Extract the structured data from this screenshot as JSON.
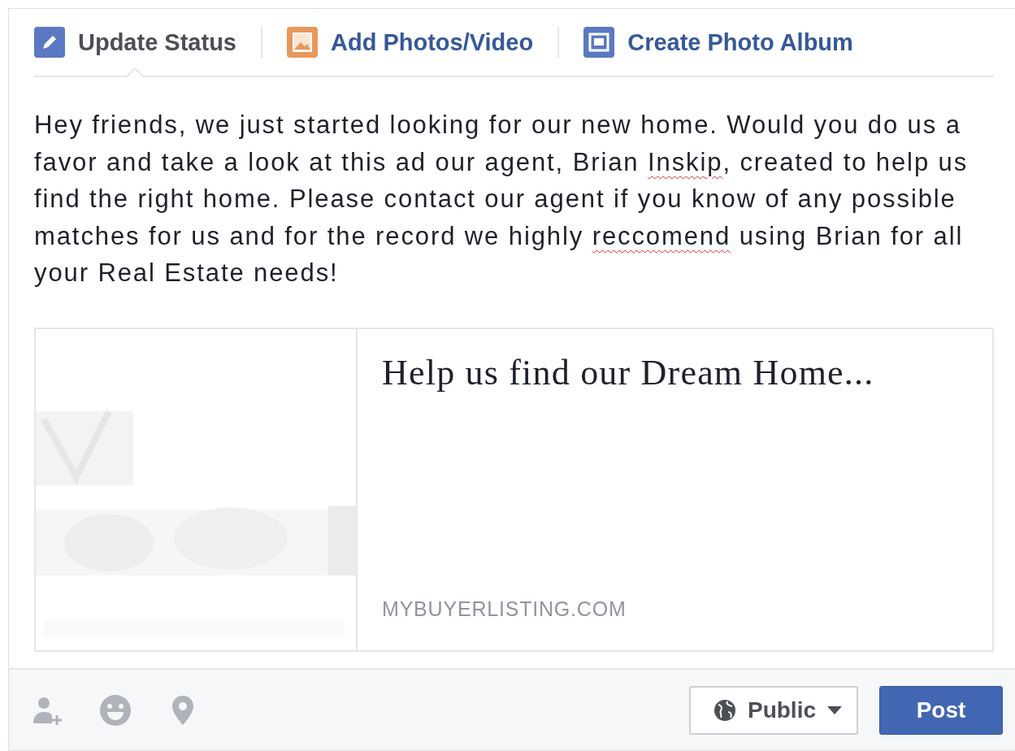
{
  "tabs": [
    {
      "label": "Update Status",
      "kind": "status",
      "selected": true
    },
    {
      "label": "Add Photos/Video",
      "selected": false
    },
    {
      "label": "Create Photo Album",
      "kind": "album",
      "selected": false
    }
  ],
  "status_text": {
    "segments": [
      {
        "text": "Hey friends, we just started looking for our new home. Would you do us a favor and take a look at this ad our agent, Brian ",
        "misspelled": false
      },
      {
        "text": "Inskip",
        "misspelled": true
      },
      {
        "text": ", created to help us find the right home. Please contact our agent if you know of any possible matches for us and for the record we highly ",
        "misspelled": false
      },
      {
        "text": "reccomend",
        "misspelled": true
      },
      {
        "text": " using Brian for all your Real Estate needs!",
        "misspelled": false
      }
    ]
  },
  "link_preview": {
    "title": "Help us find our Dream Home...",
    "domain": "MYBUYERLISTING.COM"
  },
  "footer": {
    "tools": [
      {
        "kind": "tag-people"
      },
      {
        "kind": "feeling"
      },
      {
        "kind": "location"
      }
    ],
    "audience": "Public",
    "post_button": "Post"
  }
}
